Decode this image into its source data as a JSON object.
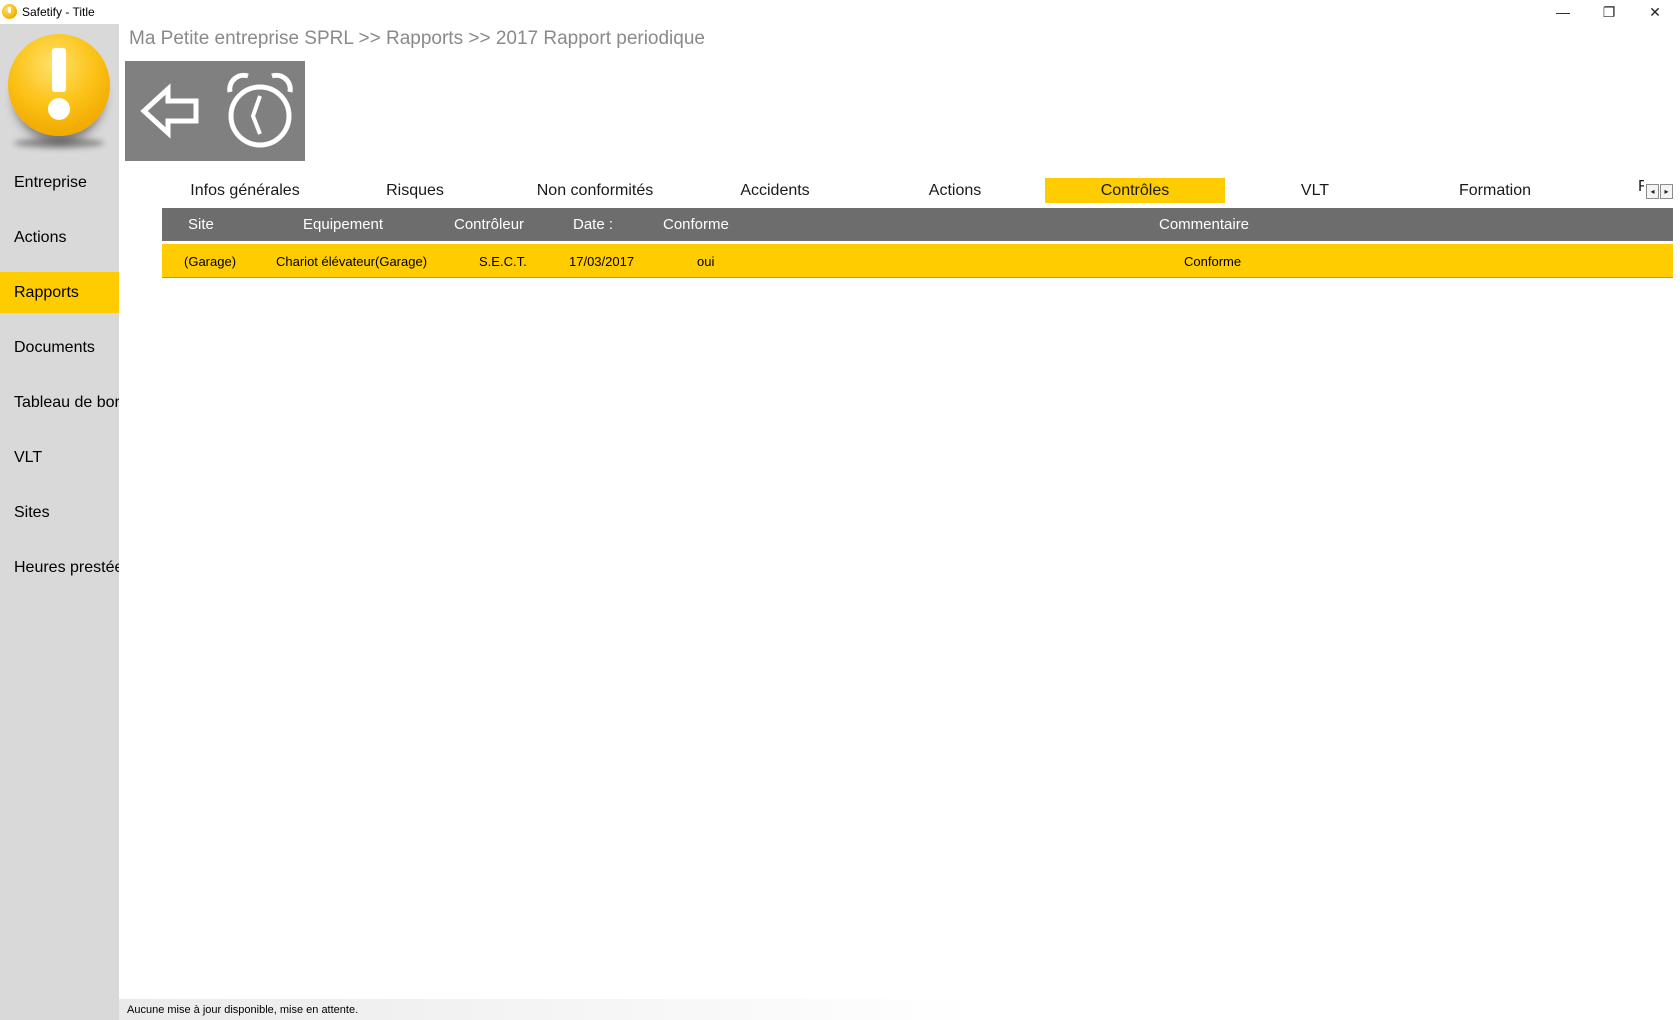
{
  "window": {
    "title": "Safetify - Title",
    "minimize_glyph": "—",
    "maximize_glyph": "❐",
    "close_glyph": "✕"
  },
  "sidebar": {
    "logo_icon": "exclamation-logo",
    "items": [
      {
        "label": "Entreprise",
        "active": false
      },
      {
        "label": "Actions",
        "active": false
      },
      {
        "label": "Rapports",
        "active": true
      },
      {
        "label": "Documents",
        "active": false
      },
      {
        "label": "Tableau de bord",
        "active": false
      },
      {
        "label": "VLT",
        "active": false
      },
      {
        "label": "Sites",
        "active": false
      },
      {
        "label": "Heures prestées",
        "active": false
      }
    ]
  },
  "breadcrumb": "Ma Petite entreprise SPRL >> Rapports >> 2017 Rapport periodique",
  "toolbar": {
    "back_icon": "back-arrow-icon",
    "clock_icon": "alarm-clock-icon"
  },
  "tabs": {
    "items": [
      "Infos générales",
      "Risques",
      "Non conformités",
      "Accidents",
      "Actions",
      "Contrôles",
      "VLT",
      "Formation"
    ],
    "active": "Contrôles",
    "overflow_label": "F",
    "scroll_left_glyph": "◂",
    "scroll_right_glyph": "▸"
  },
  "grid": {
    "columns": [
      "Site",
      "Equipement",
      "Contrôleur",
      "Date :",
      "Conforme",
      "Commentaire"
    ],
    "rows": [
      [
        "(Garage)",
        "Chariot élévateur(Garage)",
        "S.E.C.T.",
        "17/03/2017",
        "oui",
        "Conforme"
      ]
    ]
  },
  "status": "Aucune mise à jour disponible, mise en attente.",
  "colors": {
    "accent": "#ffcc00",
    "sidebar_bg": "#d9d9d9",
    "grid_header_bg": "#6d6d6d",
    "toolbar_bg": "#808080",
    "breadcrumb_text": "#8a8a8a"
  }
}
